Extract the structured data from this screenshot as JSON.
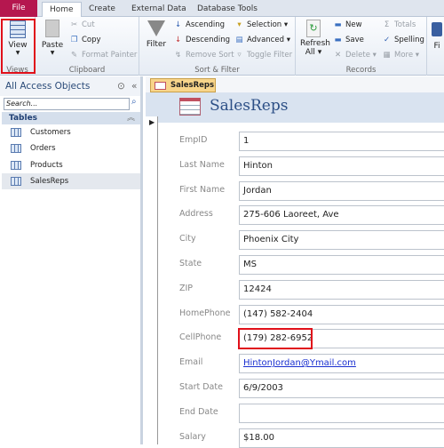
{
  "tabs": [
    "File",
    "Home",
    "Create",
    "External Data",
    "Database Tools"
  ],
  "ribbon": {
    "views": {
      "view": "View",
      "label": "Views"
    },
    "clipboard": {
      "paste": "Paste",
      "cut": "Cut",
      "copy": "Copy",
      "format_painter": "Format Painter",
      "label": "Clipboard"
    },
    "sort_filter": {
      "filter": "Filter",
      "ascending": "Ascending",
      "descending": "Descending",
      "remove_sort": "Remove Sort",
      "selection": "Selection",
      "advanced": "Advanced",
      "toggle_filter": "Toggle Filter",
      "label": "Sort & Filter"
    },
    "records": {
      "refresh": "Refresh",
      "refresh2": "All",
      "new": "New",
      "save": "Save",
      "delete": "Delete",
      "totals": "Totals",
      "spelling": "Spelling",
      "more": "More",
      "label": "Records"
    },
    "find": {
      "label": "Fi"
    }
  },
  "nav": {
    "title": "All Access Objects",
    "search_placeholder": "Search...",
    "group": "Tables",
    "items": [
      "Customers",
      "Orders",
      "Products",
      "SalesReps"
    ],
    "selected": "SalesReps"
  },
  "document": {
    "tab": "SalesReps",
    "title": "SalesReps"
  },
  "form": {
    "fields": [
      {
        "label": "EmpID",
        "value": "1"
      },
      {
        "label": "Last Name",
        "value": "Hinton"
      },
      {
        "label": "First Name",
        "value": "Jordan"
      },
      {
        "label": "Address",
        "value": "275-606 Laoreet, Ave"
      },
      {
        "label": "City",
        "value": "Phoenix City"
      },
      {
        "label": "State",
        "value": "MS"
      },
      {
        "label": "ZIP",
        "value": "12424"
      },
      {
        "label": "HomePhone",
        "value": "(147) 582-2404"
      },
      {
        "label": "CellPhone",
        "value": "(179) 282-6952"
      },
      {
        "label": "Email",
        "value": "HintonJordan@Ymail.com",
        "link": true
      },
      {
        "label": "Start Date",
        "value": "6/9/2003"
      },
      {
        "label": "End Date",
        "value": ""
      },
      {
        "label": "Salary",
        "value": "$18.00"
      }
    ]
  },
  "colors": {
    "file_tab": "#b5174f",
    "highlight": "#e0101a",
    "link": "#1a2fd0"
  }
}
